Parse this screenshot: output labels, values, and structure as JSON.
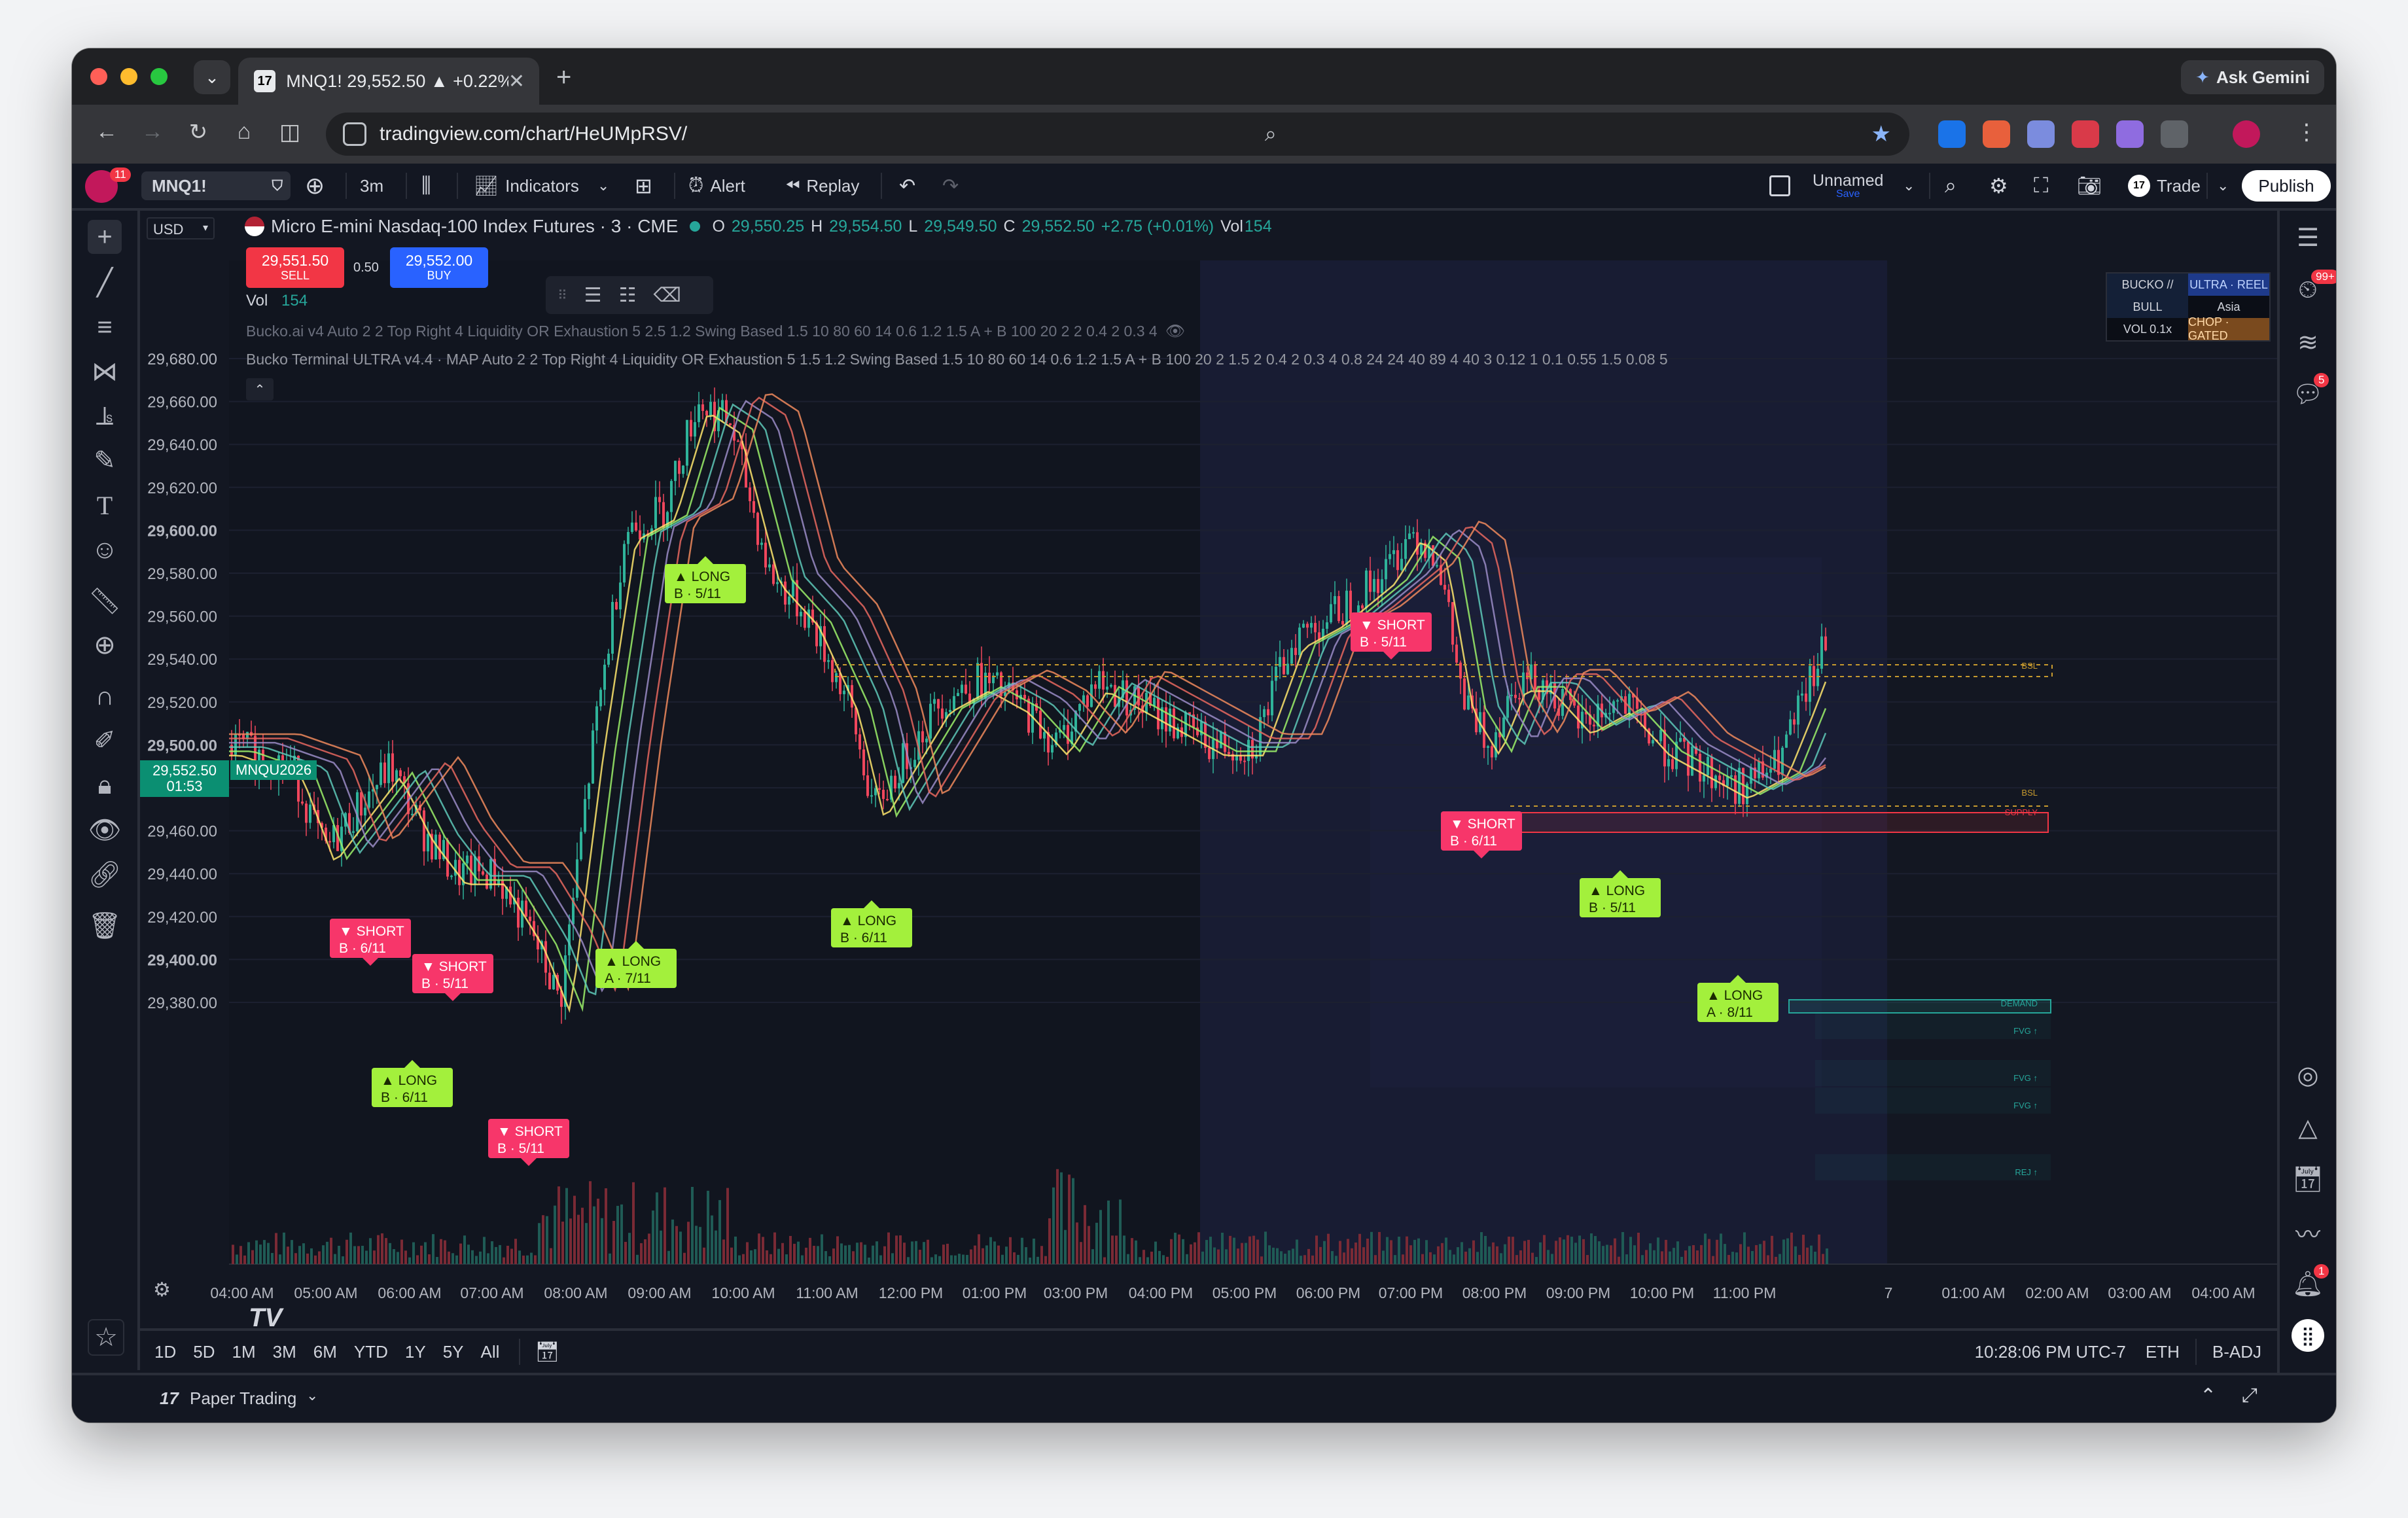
{
  "browser": {
    "tab_title": "MNQ1! 29,552.50 ▲ +0.22%",
    "url": "tradingview.com/chart/HeUMpRSV/",
    "gemini_label": "Ask Gemini"
  },
  "toolbar": {
    "symbol": "MNQ1!",
    "notification_count": "11",
    "interval": "3m",
    "indicators_label": "Indicators",
    "alert_label": "Alert",
    "replay_label": "Replay",
    "layout_name": "Unnamed",
    "layout_save": "Save",
    "trade_label": "Trade",
    "publish_label": "Publish"
  },
  "chart_header": {
    "currency": "USD",
    "title": "Micro E-mini Nasdaq-100 Index Futures · 3 · CME",
    "ohlc": {
      "o_label": "O",
      "o": "29,550.25",
      "h_label": "H",
      "h": "29,554.50",
      "l_label": "L",
      "l": "29,549.50",
      "c_label": "C",
      "c": "29,552.50",
      "change": "+2.75 (+0.01%)",
      "vol_label": "Vol",
      "vol": "154"
    },
    "sell_price": "29,551.50",
    "sell_label": "SELL",
    "spread": "0.50",
    "buy_price": "29,552.00",
    "buy_label": "BUY",
    "vol_row_label": "Vol",
    "vol_row_value": "154",
    "indicator1": "Bucko.ai v4 Auto 2 2 Top Right 4 Liquidity OR Exhaustion 5 2.5 1.2 Swing Based 1.5 10 80 60 14 0.6 1.2 1.5 A + B 100 20 2 2 0.4 2 0.3 4",
    "indicator2": "Bucko Terminal ULTRA v4.4 · MAP Auto 2 2 Top Right 4 Liquidity OR Exhaustion 5 1.5 1.2 Swing Based 1.5 10 80 60 14 0.6 1.2 1.5 A + B 100 20 2 1.5 2 0.4 2 0.3 4 0.8 24 24 40 89 4 40 3 0.12 1 0.1 0.55 1.5 0.08 5"
  },
  "dashboard": {
    "r1c1": "BUCKO //",
    "r1c2": "ULTRA · REEL",
    "r2c1": "BULL",
    "r2c2": "Asia",
    "r3c1": "VOL 0.1x",
    "r3c2": "CHOP · GATED"
  },
  "price_axis": {
    "labels": [
      "29,680.00",
      "29,660.00",
      "29,640.00",
      "29,620.00",
      "29,600.00",
      "29,580.00",
      "29,560.00",
      "29,540.00",
      "29,520.00",
      "29,500.00",
      "29,480.00",
      "29,460.00",
      "29,440.00",
      "29,420.00",
      "29,400.00",
      "29,380.00"
    ],
    "current_price": "29,552.50",
    "countdown": "01:53",
    "contract_tag": "MNQU2026"
  },
  "time_axis": {
    "labels": [
      "04:00 AM",
      "05:00 AM",
      "06:00 AM",
      "07:00 AM",
      "08:00 AM",
      "09:00 AM",
      "10:00 AM",
      "11:00 AM",
      "12:00 PM",
      "01:00 PM",
      "03:00 PM",
      "04:00 PM",
      "05:00 PM",
      "06:00 PM",
      "07:00 PM",
      "08:00 PM",
      "09:00 PM",
      "10:00 PM",
      "11:00 PM",
      "7",
      "01:00 AM",
      "02:00 AM",
      "03:00 AM",
      "04:00 AM"
    ]
  },
  "zone_labels": {
    "bsl1": "BSL",
    "bsl2": "BSL",
    "supply": "SUPPLY",
    "fvg1": "FVG ↑",
    "fvg2": "FVG ↑",
    "demand": "DEMAND",
    "fvg3": "FVG ↑",
    "rej": "REJ ↑"
  },
  "signals": [
    {
      "dir": "short",
      "line1": "▼ SHORT",
      "line2": "B · 6/11"
    },
    {
      "dir": "short",
      "line1": "▼ SHORT",
      "line2": "B · 5/11"
    },
    {
      "dir": "long",
      "line1": "▲ LONG",
      "line2": "B · 6/11"
    },
    {
      "dir": "short",
      "line1": "▼ SHORT",
      "line2": "B · 5/11"
    },
    {
      "dir": "long",
      "line1": "▲ LONG",
      "line2": "A · 7/11"
    },
    {
      "dir": "long",
      "line1": "▲ LONG",
      "line2": "B · 5/11"
    },
    {
      "dir": "long",
      "line1": "▲ LONG",
      "line2": "B · 6/11"
    },
    {
      "dir": "short",
      "line1": "▼ SHORT",
      "line2": "B · 5/11"
    },
    {
      "dir": "short",
      "line1": "▼ SHORT",
      "line2": "B · 6/11"
    },
    {
      "dir": "long",
      "line1": "▲ LONG",
      "line2": "B · 5/11"
    },
    {
      "dir": "long",
      "line1": "▲ LONG",
      "line2": "A · 8/11"
    }
  ],
  "bottom": {
    "ranges": [
      "1D",
      "5D",
      "1M",
      "3M",
      "6M",
      "YTD",
      "1Y",
      "5Y",
      "All"
    ],
    "clock": "10:28:06 PM UTC-7",
    "session": "ETH",
    "adjust": "B-ADJ"
  },
  "footer": {
    "panel_label": "Paper Trading"
  },
  "right_badges": {
    "ideas": "99+",
    "chat": "5",
    "alerts": "1"
  },
  "colors": {
    "up": "#26a69a",
    "down": "#f23645",
    "long": "#a3f03c",
    "short": "#f7366a",
    "accent": "#2962ff"
  }
}
